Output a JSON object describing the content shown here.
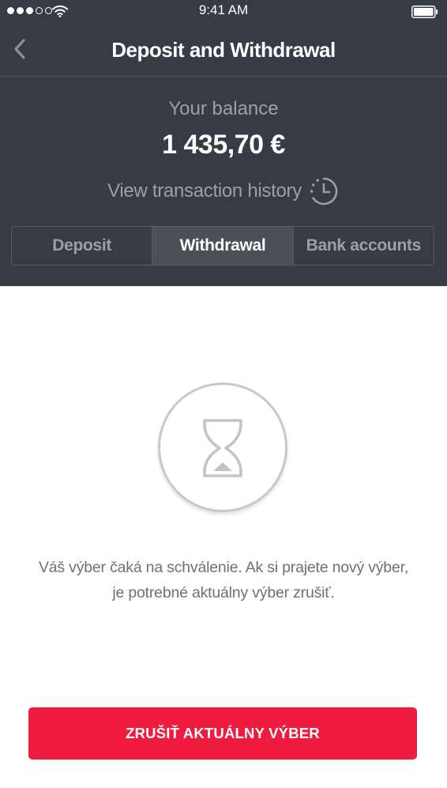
{
  "status_bar": {
    "time": "9:41 AM",
    "signal_dots": [
      true,
      true,
      true,
      false,
      false
    ]
  },
  "nav": {
    "title": "Deposit and Withdrawal",
    "back_icon": "chevron-left-icon"
  },
  "balance": {
    "label": "Your balance",
    "amount": "1 435,70 €"
  },
  "history": {
    "label": "View transaction history",
    "icon": "history-clock-icon"
  },
  "tabs": [
    {
      "label": "Deposit",
      "active": false
    },
    {
      "label": "Withdrawal",
      "active": true
    },
    {
      "label": "Bank accounts",
      "active": false
    }
  ],
  "pending": {
    "icon": "hourglass-icon",
    "message_line1": "Váš výber čaká na schválenie. Ak si prajete nový výber,",
    "message_line2": "je potrebné aktuálny výber zrušiť."
  },
  "cancel_button": {
    "label": "ZRUŠIŤ AKTUÁLNY VÝBER"
  },
  "colors": {
    "header_bg": "#363b44",
    "accent_red": "#ef1c3f",
    "active_tab_bg": "#4b5058",
    "muted_text": "#9ba0a8"
  }
}
